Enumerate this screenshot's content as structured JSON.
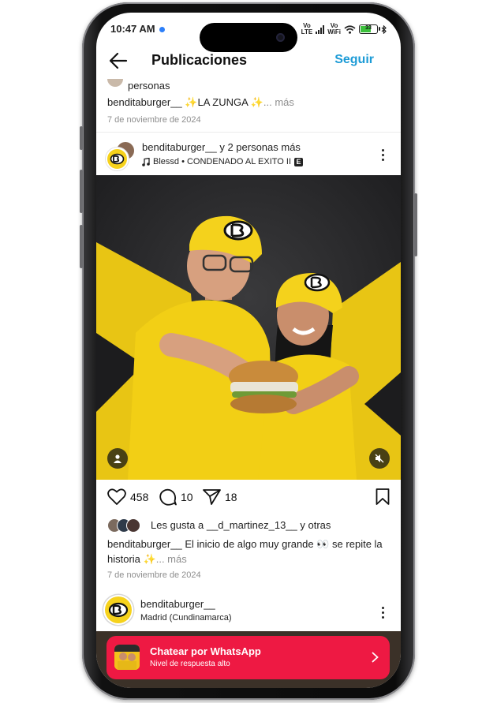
{
  "status_bar": {
    "time": "10:47 AM",
    "volte": "Vo",
    "wifi_label": "WiFi",
    "battery": "33"
  },
  "header": {
    "title": "Publicaciones",
    "follow_label": "Seguir",
    "back_icon": "arrow-left-icon"
  },
  "previous_post": {
    "people_text": "personas",
    "username": "benditaburger__",
    "caption": "✨LA ZUNGA ✨",
    "more_label": "... más",
    "date": "7 de noviembre de 2024"
  },
  "post": {
    "username": "benditaburger__",
    "collab_text": "y 2 personas más",
    "music": "Blessd • CONDENADO AL EXITO II",
    "explicit_badge": "E",
    "likes_count": "458",
    "comments_count": "10",
    "shares_count": "18",
    "liked_by_prefix": "Les gusta a",
    "liked_by_user": "__d_martinez_13__",
    "liked_by_suffix_connector": "y",
    "liked_by_others": "otras",
    "caption_user": "benditaburger__",
    "caption_text": "El inicio de algo muy grande 👀 se repite la historia ✨",
    "caption_more": "... más",
    "date": "7 de noviembre de 2024",
    "photo_logo": "B"
  },
  "next_post": {
    "username": "benditaburger__",
    "location": "Madrid (Cundinamarca)"
  },
  "whatsapp": {
    "title": "Chatear por WhatsApp",
    "subtitle": "Nivel de respuesta alto"
  },
  "colors": {
    "follow": "#1c9bd6",
    "brand_yellow": "#f6d21c",
    "whatsapp_bar": "#ee1943"
  }
}
